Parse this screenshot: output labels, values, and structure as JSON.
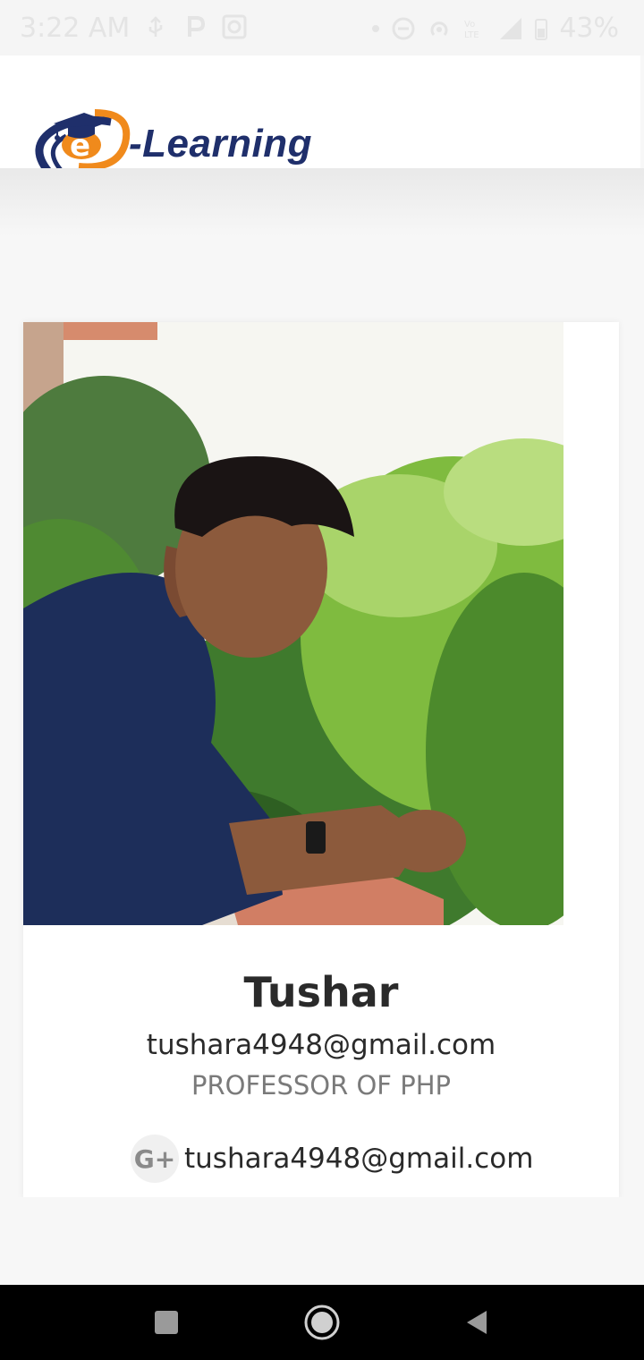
{
  "status_bar": {
    "time": "3:22 AM",
    "battery": "43%",
    "icons_left": [
      "usb-icon",
      "p-icon",
      "screenshot-icon"
    ],
    "icons_right": [
      "dot-icon",
      "dnd-icon",
      "hotspot-icon",
      "volte-icon",
      "signal-icon",
      "battery-icon"
    ]
  },
  "header": {
    "logo_letter": "e",
    "logo_text": "-Learning",
    "colors": {
      "navy": "#1f2f6b",
      "orange": "#f08a1c"
    }
  },
  "profile": {
    "name": "Tushar",
    "email": "tushara4948@gmail.com",
    "role": "PROFESSOR OF PHP",
    "google_plus_label": "G+",
    "google_plus_email": "tushara4948@gmail.com"
  },
  "nav": {
    "buttons": [
      "recents-icon",
      "home-icon",
      "back-icon"
    ]
  }
}
